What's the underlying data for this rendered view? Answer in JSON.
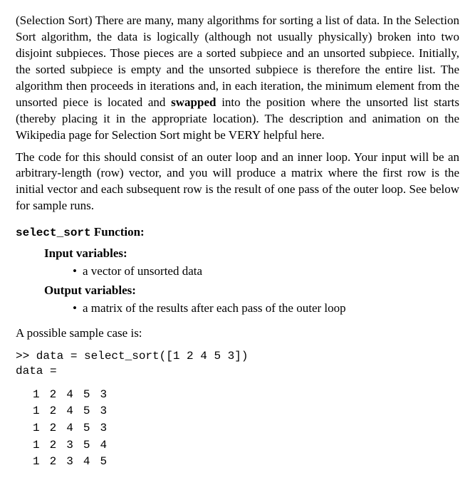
{
  "para1_lead": "(Selection Sort)",
  "para1_a": " There are many, many algorithms for sorting a list of data. In the Selection Sort algorithm, the data is logically (although not usually physically) broken into two disjoint subpieces. Those pieces are a sorted subpiece and an unsorted subpiece. Initially, the sorted subpiece is empty and the unsorted subpiece is therefore the entire list. The algorithm then proceeds in iterations and, in each iteration, the minimum element from the unsorted piece is located and ",
  "para1_bold": "swapped",
  "para1_b": " into the position where the unsorted list starts (thereby placing it in the appropriate location). The description and animation on the Wikipedia page for Selection Sort might be VERY helpful here.",
  "para2": "The code for this should consist of an outer loop and an inner loop. Your input will be an arbitrary-length (row) vector, and you will produce a matrix where the first row is the initial vector and each subsequent row is the result of one pass of the outer loop. See below for sample runs.",
  "func_name": "select_sort",
  "func_suffix": " Function:",
  "input_label": "Input variables:",
  "input_bullet": "a vector of unsorted data",
  "output_label": "Output variables:",
  "output_bullet": "a matrix of the results after each pass of the outer loop",
  "sample_text": "A possible sample case is:",
  "code_line1": ">> data = select_sort([1 2 4 5 3])",
  "code_line2": "data =",
  "matrix": [
    [
      1,
      2,
      4,
      5,
      3
    ],
    [
      1,
      2,
      4,
      5,
      3
    ],
    [
      1,
      2,
      4,
      5,
      3
    ],
    [
      1,
      2,
      3,
      5,
      4
    ],
    [
      1,
      2,
      3,
      4,
      5
    ]
  ]
}
